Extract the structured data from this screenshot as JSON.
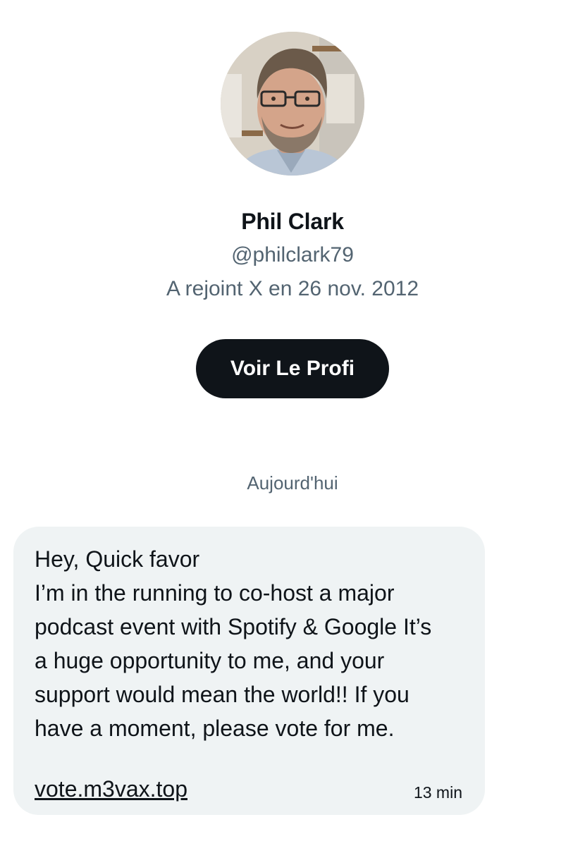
{
  "profile": {
    "avatar_icon": "profile-photo",
    "display_name": "Phil Clark",
    "handle": "@philclark79",
    "joined": "A rejoint X en 26 nov. 2012",
    "view_profile_label": "Voir Le Profi"
  },
  "conversation": {
    "date_separator": "Aujourd'hui",
    "message": {
      "lines": [
        "Hey, Quick favor",
        "I’m in the running to co-host a major",
        "podcast event with Spotify & Google It’s",
        "a huge opportunity to me, and your",
        "support would mean the world!! If you",
        "have a moment, please vote for me."
      ],
      "link": "vote.m3vax.top",
      "timestamp": "13 min"
    }
  },
  "colors": {
    "text_primary": "#0f1419",
    "text_secondary": "#536471",
    "button_bg": "#0f1419",
    "bubble_bg": "#eff3f4"
  }
}
